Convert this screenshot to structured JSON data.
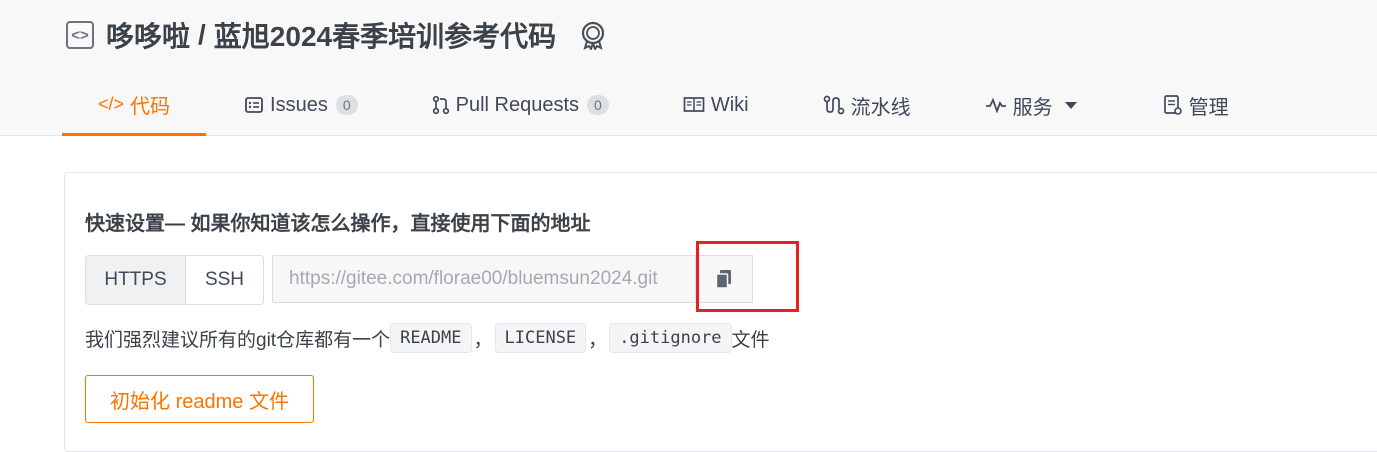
{
  "repo": {
    "owner": "哆哆啦",
    "separator": "/",
    "name": "蓝旭2024春季培训参考代码"
  },
  "tabs": {
    "code": {
      "label": "代码",
      "icon": "code-icon"
    },
    "issues": {
      "label": "Issues",
      "count": "0",
      "icon": "issues-icon"
    },
    "pulls": {
      "label": "Pull Requests",
      "count": "0",
      "icon": "pull-request-icon"
    },
    "wiki": {
      "label": "Wiki",
      "icon": "book-icon"
    },
    "pipeline": {
      "label": "流水线",
      "icon": "pipeline-icon"
    },
    "services": {
      "label": "服务",
      "icon": "activity-icon"
    },
    "manage": {
      "label": "管理",
      "icon": "settings-doc-icon"
    }
  },
  "quick_setup": {
    "title": "快速设置— 如果你知道该怎么操作，直接使用下面的地址",
    "protocols": [
      "HTTPS",
      "SSH"
    ],
    "url": "https://gitee.com/florae00/bluemsun2024.git",
    "suggest_prefix": "我们强烈建议所有的git仓库都有一个",
    "files": [
      "README",
      "LICENSE",
      ".gitignore"
    ],
    "comma": "，",
    "suggest_suffix": "文件",
    "init_button": "初始化 readme 文件"
  },
  "colors": {
    "accent": "#fe7300",
    "highlight": "#e8201f"
  }
}
